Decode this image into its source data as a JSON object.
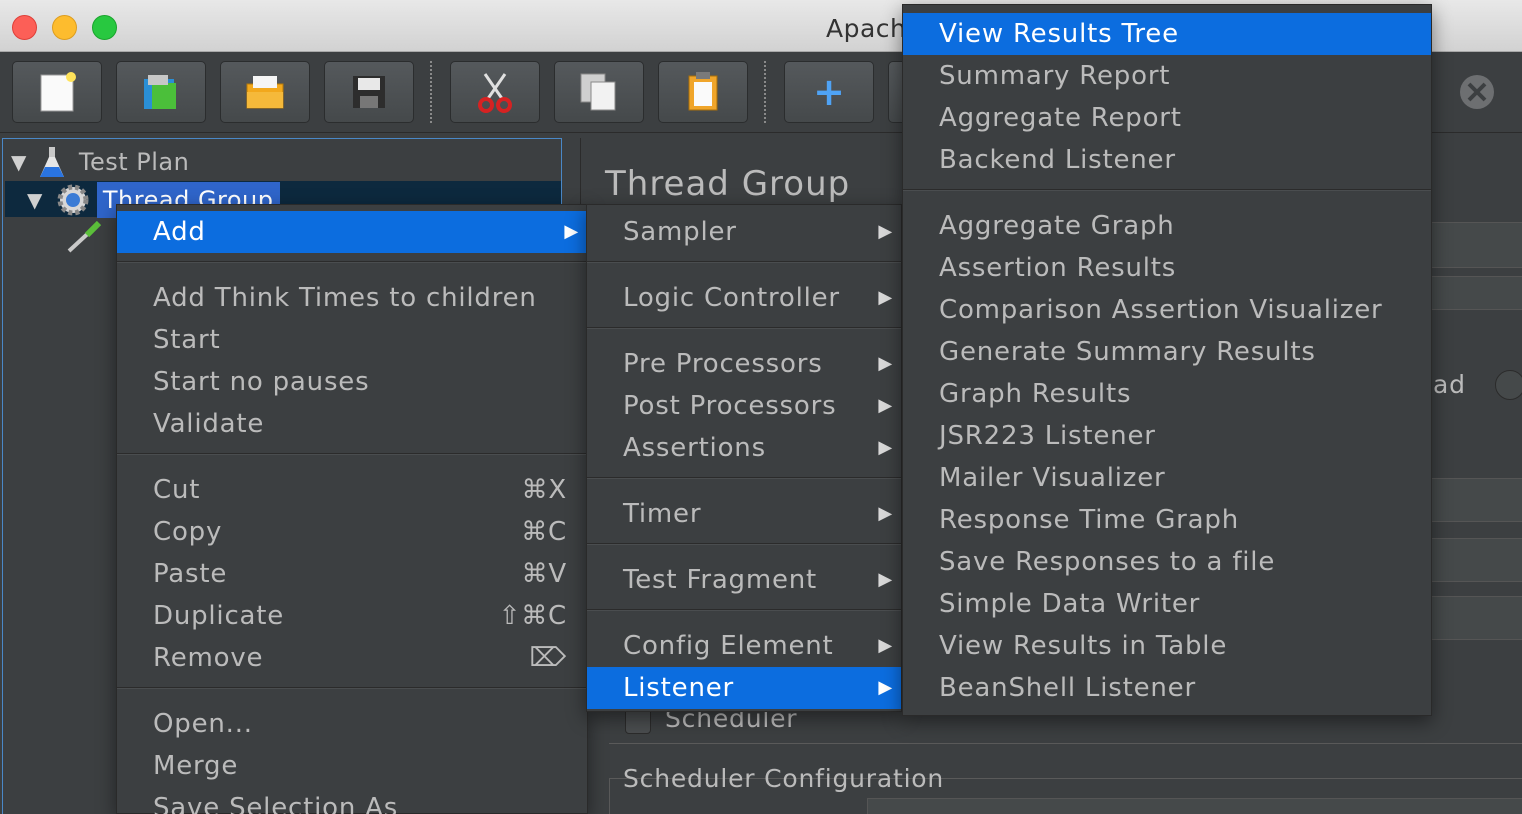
{
  "window": {
    "title": "Apach"
  },
  "toolbar": {
    "buttons": [
      {
        "name": "new-icon"
      },
      {
        "name": "templates-icon"
      },
      {
        "name": "open-icon"
      },
      {
        "name": "save-icon"
      },
      {
        "name": "cut-icon"
      },
      {
        "name": "copy-icon"
      },
      {
        "name": "paste-icon"
      },
      {
        "name": "expand-icon"
      },
      {
        "name": "clear-all-icon"
      }
    ],
    "expand_glyph": "+"
  },
  "tree": {
    "test_plan": "Test Plan",
    "thread_group": "Thread Group",
    "expanded_glyph": "▼"
  },
  "right_panel": {
    "title": "Thread Group",
    "partial_label": "ad",
    "scheduler_checkbox": "Scheduler",
    "scheduler_config": "Scheduler Configuration"
  },
  "context_menu": {
    "add": "Add",
    "add_think_times": "Add Think Times to children",
    "start": "Start",
    "start_no_pauses": "Start no pauses",
    "validate": "Validate",
    "cut": "Cut",
    "cut_shortcut": "⌘X",
    "copy": "Copy",
    "copy_shortcut": "⌘C",
    "paste": "Paste",
    "paste_shortcut": "⌘V",
    "duplicate": "Duplicate",
    "duplicate_shortcut": "⇧⌘C",
    "remove": "Remove",
    "remove_shortcut": "⌦",
    "open": "Open...",
    "merge": "Merge",
    "save_selection_as": "Save Selection As",
    "submenu_arrow": "▶"
  },
  "add_submenu": {
    "sampler": "Sampler",
    "logic_controller": "Logic Controller",
    "pre_processors": "Pre Processors",
    "post_processors": "Post Processors",
    "assertions": "Assertions",
    "timer": "Timer",
    "test_fragment": "Test Fragment",
    "config_element": "Config Element",
    "listener": "Listener"
  },
  "listener_submenu": {
    "items_top": [
      "View Results Tree",
      "Summary Report",
      "Aggregate Report",
      "Backend Listener"
    ],
    "items_bottom": [
      "Aggregate Graph",
      "Assertion Results",
      "Comparison Assertion Visualizer",
      "Generate Summary Results",
      "Graph Results",
      "JSR223 Listener",
      "Mailer Visualizer",
      "Response Time Graph",
      "Save Responses to a file",
      "Simple Data Writer",
      "View Results in Table",
      "BeanShell Listener"
    ]
  },
  "colors": {
    "selection": "#0c6ddf",
    "background": "#3c3f41",
    "text": "#bbbbbb"
  }
}
